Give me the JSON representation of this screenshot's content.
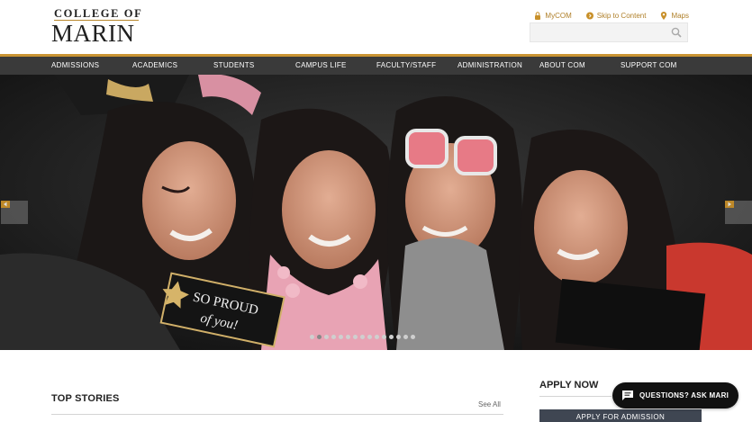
{
  "logo": {
    "top_line": "COLLEGE OF",
    "main": "MARIN"
  },
  "utility_links": [
    {
      "label": "MyCOM",
      "icon": "lock-icon"
    },
    {
      "label": "Skip to Content",
      "icon": "chevron-circle-icon"
    },
    {
      "label": "Maps",
      "icon": "map-pin-icon"
    }
  ],
  "search": {
    "placeholder": ""
  },
  "nav": [
    "ADMISSIONS",
    "ACADEMICS",
    "STUDENTS",
    "CAMPUS LIFE",
    "FACULTY/STAFF",
    "ADMINISTRATION",
    "ABOUT COM",
    "SUPPORT COM"
  ],
  "hero": {
    "sign_text_line1": "SO PROUD",
    "sign_text_line2": "of you!",
    "slide_count": 15,
    "active_slide": 2,
    "prev_icon": "triangle-left-icon",
    "next_icon": "triangle-right-icon"
  },
  "top_stories": {
    "heading": "TOP STORIES",
    "see_all": "See All"
  },
  "apply": {
    "heading": "APPLY NOW",
    "button": "APPLY FOR ADMISSION"
  },
  "chat": {
    "label": "QUESTIONS? ASK MARI",
    "icon": "chat-bubble-icon"
  },
  "colors": {
    "gold": "#c99433",
    "nav_bg": "#3a3a3a",
    "apply_btn": "#3f4652",
    "chat_bg": "#111111"
  }
}
